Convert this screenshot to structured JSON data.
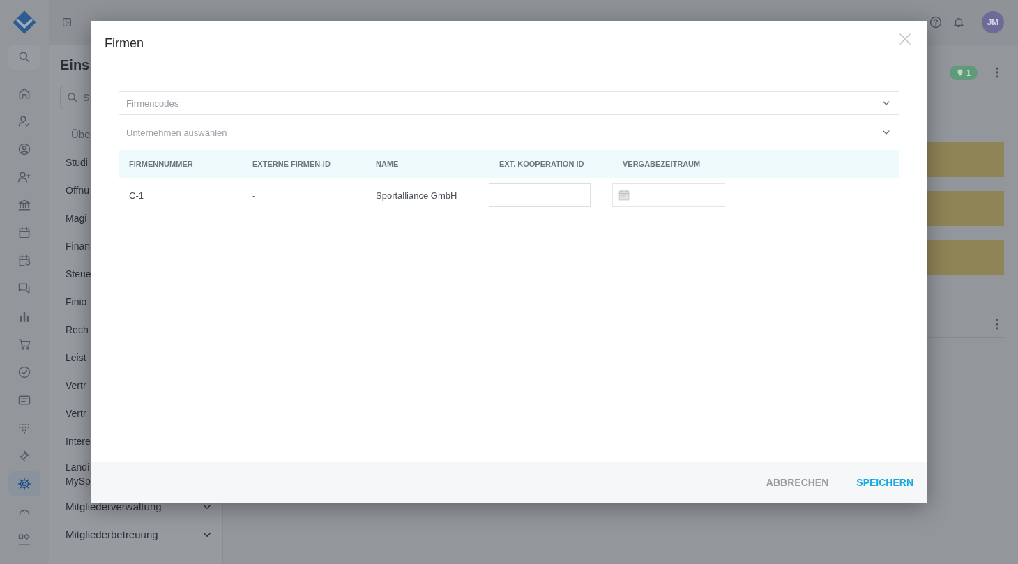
{
  "topbar": {
    "avatar": "JM"
  },
  "rail": [
    {
      "selected": false
    },
    {
      "selected": false
    },
    {
      "selected": false
    },
    {
      "selected": false
    },
    {
      "selected": false
    },
    {
      "selected": false
    },
    {
      "selected": false
    },
    {
      "selected": false
    },
    {
      "selected": false
    },
    {
      "selected": false
    },
    {
      "selected": false
    },
    {
      "selected": false
    },
    {
      "selected": false
    },
    {
      "selected": false
    },
    {
      "selected": false
    },
    {
      "selected": true
    },
    {
      "selected": false
    },
    {
      "selected": false
    }
  ],
  "settings_panel": {
    "title": "Eins",
    "search_placeholder": "S",
    "tab": "Übe",
    "items": [
      {
        "label": "Studi",
        "kind": "link"
      },
      {
        "label": "Öffnu",
        "kind": "link"
      },
      {
        "label": "Magi",
        "kind": "link"
      },
      {
        "label": "Finan",
        "kind": "link"
      },
      {
        "label": "Steue",
        "kind": "link"
      },
      {
        "label": "Finio",
        "kind": "link"
      },
      {
        "label": "Rech",
        "kind": "link"
      },
      {
        "label": "Leist",
        "kind": "link"
      },
      {
        "label": "Vertr",
        "kind": "link"
      },
      {
        "label": "Vertr",
        "kind": "link"
      },
      {
        "label": "Intere",
        "kind": "link"
      },
      {
        "label": "Landi\nMySp",
        "kind": "link"
      },
      {
        "label": "Mitgliederverwaltung",
        "kind": "group",
        "expanded": false
      },
      {
        "label": "Mitgliederbetreuung",
        "kind": "group",
        "expanded": false
      }
    ]
  },
  "main": {
    "location_badge": "1"
  },
  "dialog": {
    "title": "Firmen",
    "selects": [
      {
        "placeholder": "Firmencodes"
      },
      {
        "placeholder": "Unternehmen auswählen"
      }
    ],
    "table": {
      "columns": [
        "FIRMENNUMMER",
        "EXTERNE FIRMEN-ID",
        "NAME",
        "EXT. KOOPERATION ID",
        "VERGABEZEITRAUM"
      ],
      "rows": [
        {
          "cells": [
            "C-1",
            "-",
            "Sportalliance GmbH"
          ]
        }
      ]
    },
    "buttons": [
      {
        "label": "ABBRECHEN",
        "kind": "secondary"
      },
      {
        "label": "SPEICHERN",
        "kind": "primary"
      }
    ]
  }
}
